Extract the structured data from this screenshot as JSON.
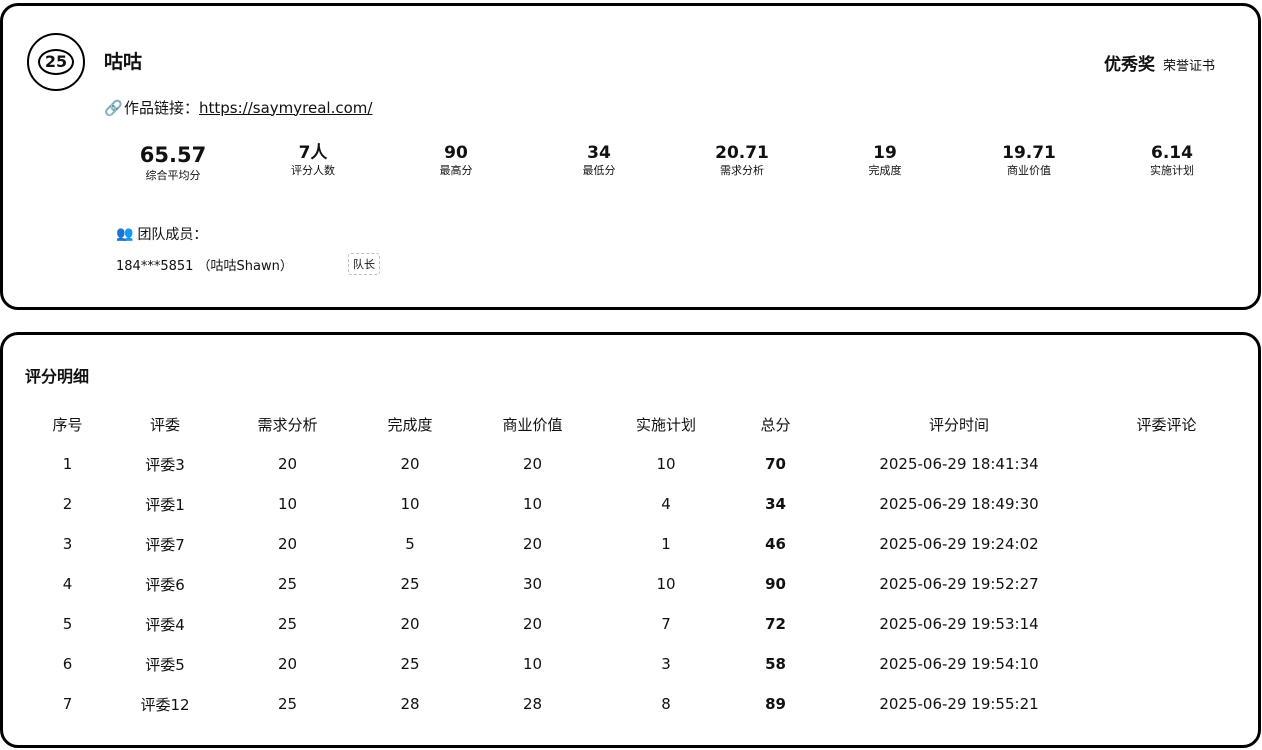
{
  "team": {
    "rank": "25",
    "name": "咕咕",
    "award_title": "优秀奖",
    "award_subtitle": "荣誉证书",
    "link_icon": "🔗",
    "link_label": "作品链接：",
    "link_url": "https://saymyreal.com/"
  },
  "stats": [
    {
      "value": "65.57",
      "label": "综合平均分"
    },
    {
      "value": "7人",
      "label": "评分人数"
    },
    {
      "value": "90",
      "label": "最高分"
    },
    {
      "value": "34",
      "label": "最低分"
    },
    {
      "value": "20.71",
      "label": "需求分析"
    },
    {
      "value": "19",
      "label": "完成度"
    },
    {
      "value": "19.71",
      "label": "商业价值"
    },
    {
      "value": "6.14",
      "label": "实施计划"
    }
  ],
  "members": {
    "icon": "👥",
    "title": "团队成员：",
    "list": [
      {
        "contact": "184***5851 （咕咕Shawn）",
        "role": "队长"
      }
    ]
  },
  "details": {
    "title": "评分明细",
    "headers": [
      "序号",
      "评委",
      "需求分析",
      "完成度",
      "商业价值",
      "实施计划",
      "总分",
      "评分时间",
      "评委评论"
    ],
    "rows": [
      [
        "1",
        "评委3",
        "20",
        "20",
        "20",
        "10",
        "70",
        "2025-06-29 18:41:34",
        ""
      ],
      [
        "2",
        "评委1",
        "10",
        "10",
        "10",
        "4",
        "34",
        "2025-06-29 18:49:30",
        ""
      ],
      [
        "3",
        "评委7",
        "20",
        "5",
        "20",
        "1",
        "46",
        "2025-06-29 19:24:02",
        ""
      ],
      [
        "4",
        "评委6",
        "25",
        "25",
        "30",
        "10",
        "90",
        "2025-06-29 19:52:27",
        ""
      ],
      [
        "5",
        "评委4",
        "25",
        "20",
        "20",
        "7",
        "72",
        "2025-06-29 19:53:14",
        ""
      ],
      [
        "6",
        "评委5",
        "20",
        "25",
        "10",
        "3",
        "58",
        "2025-06-29 19:54:10",
        ""
      ],
      [
        "7",
        "评委12",
        "25",
        "28",
        "28",
        "8",
        "89",
        "2025-06-29 19:55:21",
        ""
      ]
    ]
  }
}
